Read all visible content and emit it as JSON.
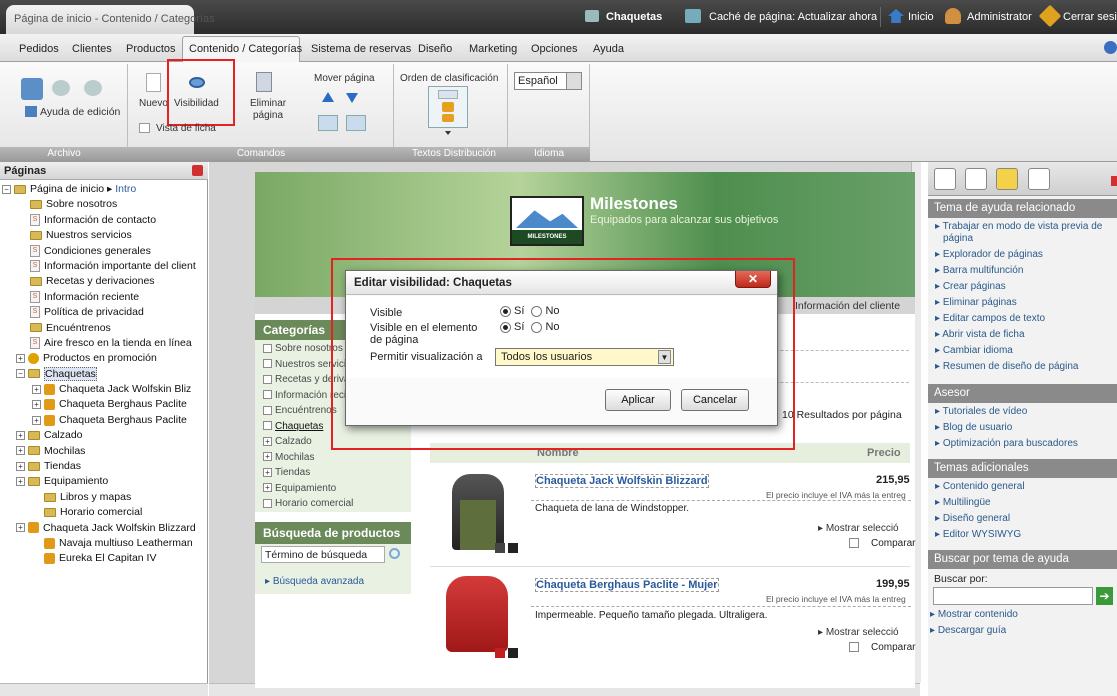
{
  "browser": {
    "tab_title": "Página de inicio - Contenido / Categorías"
  },
  "topbar": {
    "page_label": "Chaquetas",
    "cache_label": "Caché de página: Actualizar ahora",
    "home": "Inicio",
    "admin": "Administrator",
    "logout": "Cerrar sesió"
  },
  "menu": {
    "items": [
      "Pedidos",
      "Clientes",
      "Productos",
      "Contenido / Categorías",
      "Sistema de reservas",
      "Diseño",
      "Marketing",
      "Opciones",
      "Ayuda"
    ]
  },
  "ribbon": {
    "help_edit": "Ayuda de edición",
    "group_archivo": "Archivo",
    "nuevo": "Nuevo",
    "visibilidad": "Visibilidad",
    "eliminar": "Eliminar",
    "pagina": "página",
    "vista_ficha": "Vista de ficha",
    "group_comandos": "Comandos",
    "mover": "Mover página",
    "orden": "Orden de clasificación",
    "tab_textos": "Textos",
    "tab_distribucion": "Distribución",
    "idioma_value": "Español",
    "group_idioma": "Idioma"
  },
  "tree": {
    "header": "Páginas",
    "root": "Página de inicio",
    "root_link": "Intro",
    "items": [
      "Sobre nosotros",
      "Información de contacto",
      "Nuestros servicios",
      "Condiciones generales",
      "Información importante del client",
      "Recetas y derivaciones",
      "Información reciente",
      "Política de privacidad",
      "Encuéntrenos",
      "Aire fresco en la tienda en línea",
      "Productos en promoción",
      "Chaquetas",
      "Chaqueta Jack Wolfskin Bliz",
      "Chaqueta Berghaus Paclite",
      "Chaqueta Berghaus Paclite",
      "Calzado",
      "Mochilas",
      "Tiendas",
      "Equipamiento",
      "Libros y mapas",
      "Horario comercial",
      "Chaqueta Jack Wolfskin Blizzard",
      "Navaja multiuso Leatherman",
      "Eureka El Capitan IV"
    ]
  },
  "site": {
    "brand": "Milestones",
    "tagline": "Equipados para alcanzar sus objetivos",
    "logo_text": "MILESTONES",
    "nav_right": "Información del cliente",
    "cat_head": "Categorías",
    "cats": [
      "Sobre nosotros",
      "Nuestros servicios",
      "Recetas y derivaciones",
      "Información reciente",
      "Encuéntrenos",
      "Chaquetas",
      "Calzado",
      "Mochilas",
      "Tiendas",
      "Equipamiento",
      "Horario comercial"
    ],
    "search_head": "Búsqueda de productos",
    "search_placeholder": "Término de búsqueda",
    "adv_search": "Búsqueda avanzada",
    "results": "10 Resultados por página",
    "col_name": "Nombre",
    "col_price": "Precio",
    "products": [
      {
        "name": "Chaqueta Jack Wolfskin Blizzard",
        "price": "215,95",
        "vat": "El precio incluye el IVA más la entreg",
        "desc": "Chaqueta de lana de Windstopper.",
        "show": "Mostrar selecció",
        "compare": "Comparar"
      },
      {
        "name": "Chaqueta Berghaus Paclite - Mujer",
        "price": "199,95",
        "vat": "El precio incluye el IVA más la entreg",
        "desc": "Impermeable. Pequeño tamaño plegada. Ultraligera.",
        "show": "Mostrar selecció",
        "compare": "Comparar"
      }
    ]
  },
  "dialog": {
    "title": "Editar visibilidad: Chaquetas",
    "visible_label": "Visible",
    "visible_el_label": "Visible en el elemento de página",
    "allow_label": "Permitir visualización a",
    "yes": "Sí",
    "no": "No",
    "select_value": "Todos los usuarios",
    "apply": "Aplicar",
    "cancel": "Cancelar"
  },
  "help": {
    "head1": "Tema de ayuda relacionado",
    "links1": [
      "Trabajar en modo de vista previa de página",
      "Explorador de páginas",
      "Barra multifunción",
      "Crear páginas",
      "Eliminar páginas",
      "Editar campos de texto",
      "Abrir vista de ficha",
      "Cambiar idioma",
      "Resumen de diseño de página"
    ],
    "head2": "Asesor",
    "links2": [
      "Tutoriales de vídeo",
      "Blog de usuario",
      "Optimización para buscadores"
    ],
    "head3": "Temas adicionales",
    "links3": [
      "Contenido general",
      "Multilingüe",
      "Diseño general",
      "Editor WYSIWYG"
    ],
    "head4": "Buscar por tema de ayuda",
    "search_label": "Buscar por:",
    "links4": [
      "Mostrar contenido",
      "Descargar guía"
    ]
  }
}
